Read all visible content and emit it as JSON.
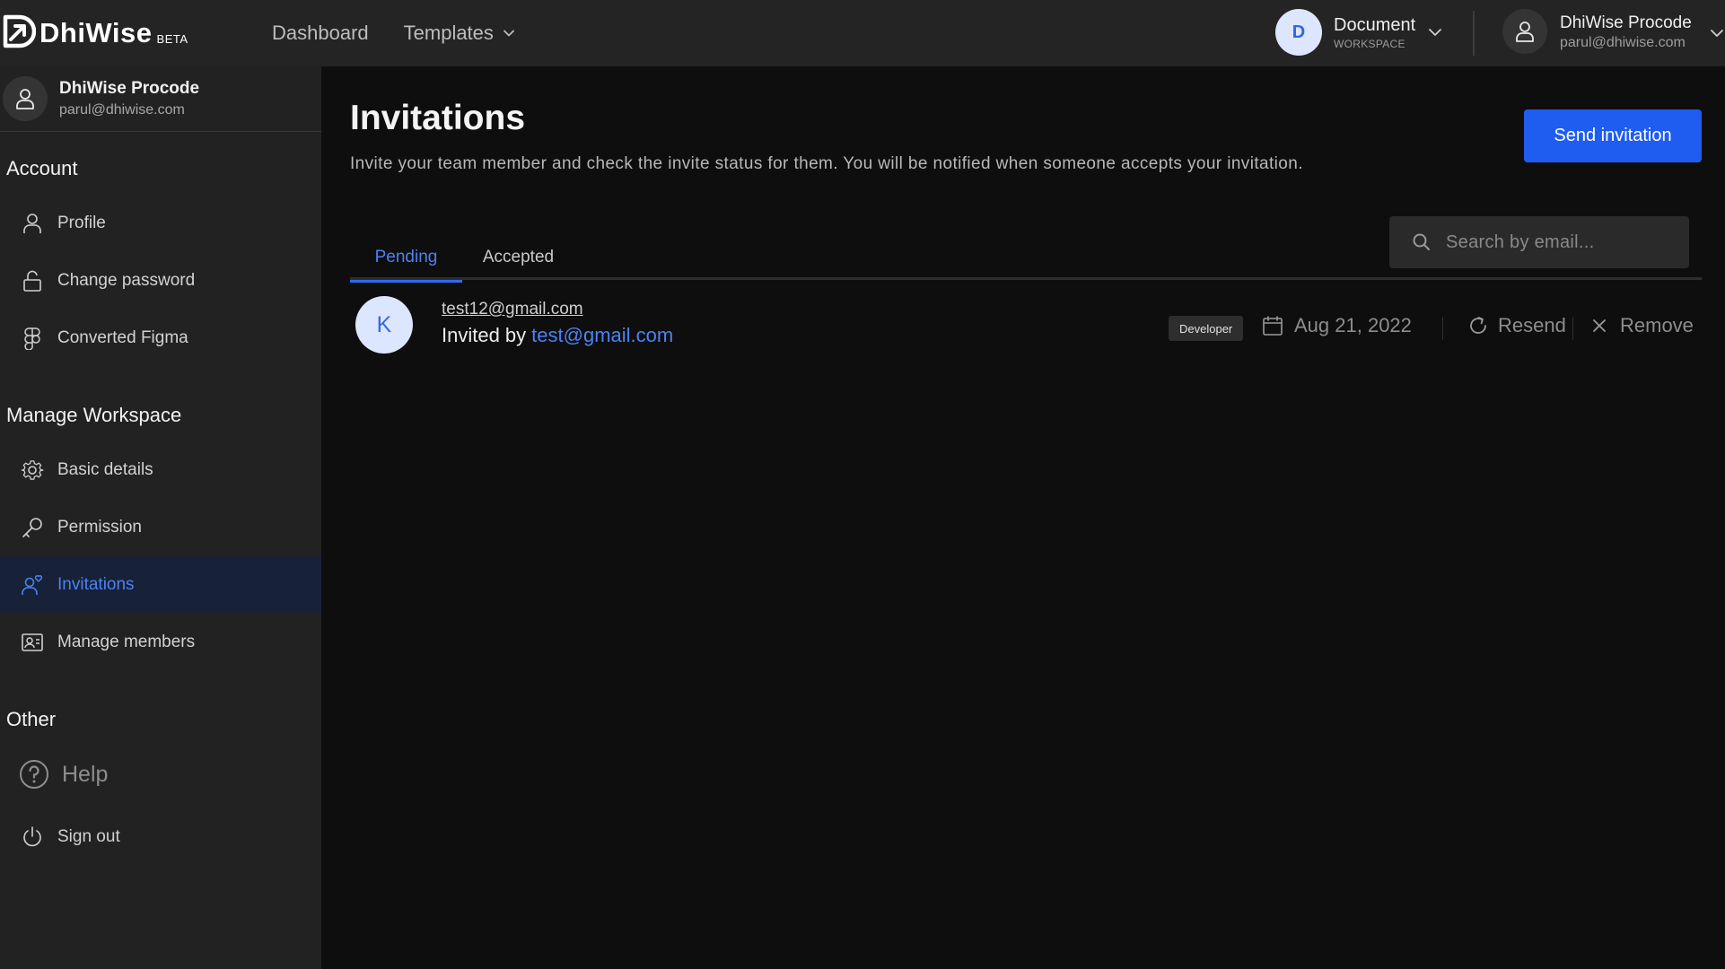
{
  "brand": {
    "name": "DhiWise",
    "badge": "BETA"
  },
  "topnav": {
    "dashboard": "Dashboard",
    "templates": "Templates"
  },
  "workspace": {
    "initial": "D",
    "name": "Document",
    "label": "WORKSPACE"
  },
  "user": {
    "name": "DhiWise Procode",
    "email": "parul@dhiwise.com"
  },
  "sidebar": {
    "sections": {
      "account": "Account",
      "manage": "Manage Workspace",
      "other": "Other"
    },
    "items": {
      "profile": "Profile",
      "change_password": "Change password",
      "converted_figma": "Converted Figma",
      "basic_details": "Basic details",
      "permission": "Permission",
      "invitations": "Invitations",
      "manage_members": "Manage members",
      "help": "Help",
      "sign_out": "Sign out"
    },
    "active": "invitations"
  },
  "page": {
    "title": "Invitations",
    "description": "Invite your team member and check the invite status for them. You will be notified when someone accepts your invitation.",
    "send_button": "Send invitation",
    "search_placeholder": "Search by email...",
    "tabs": {
      "pending": "Pending",
      "accepted": "Accepted"
    },
    "active_tab": "pending"
  },
  "invitations": [
    {
      "initial": "K",
      "email": "test12@gmail.com",
      "invited_by_label": "Invited by",
      "invited_by": "test@gmail.com",
      "role": "Developer",
      "date": "Aug 21, 2022",
      "resend_label": "Resend",
      "remove_label": "Remove"
    }
  ],
  "colors": {
    "accent": "#1f5cf0",
    "active_text": "#4b82f3",
    "active_bg": "#172137"
  }
}
